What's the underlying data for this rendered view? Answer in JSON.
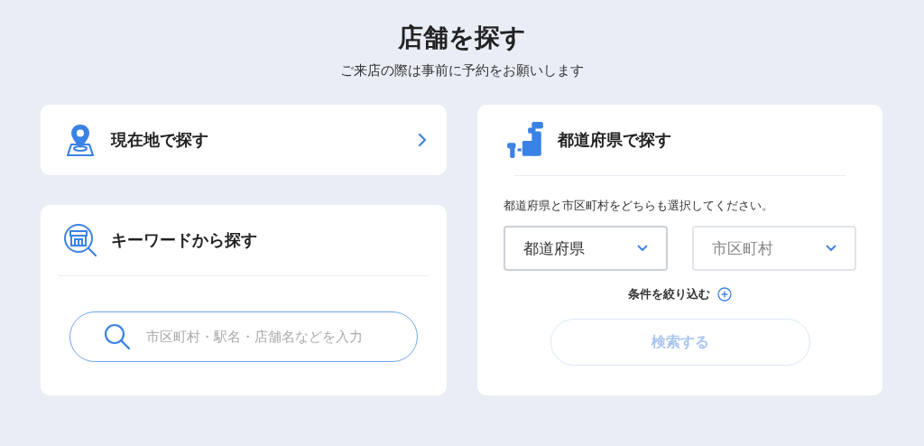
{
  "header": {
    "title": "店舗を探す",
    "subtitle": "ご来店の際は事前に予約をお願いします"
  },
  "current_location": {
    "label": "現在地で探す"
  },
  "keyword": {
    "title": "キーワードから探す",
    "search": {
      "placeholder": "市区町村・駅名・店舗名などを入力"
    }
  },
  "prefecture": {
    "title": "都道府県で探す",
    "instruction": "都道府県と市区町村をどちらも選択してください。",
    "selects": [
      {
        "value": "都道府県",
        "disabled": false
      },
      {
        "value": "市区町村",
        "disabled": true
      }
    ],
    "filter": {
      "label": "条件を絞り込む",
      "expanded": false
    },
    "search_button": {
      "label": "検索する",
      "disabled": true
    }
  }
}
